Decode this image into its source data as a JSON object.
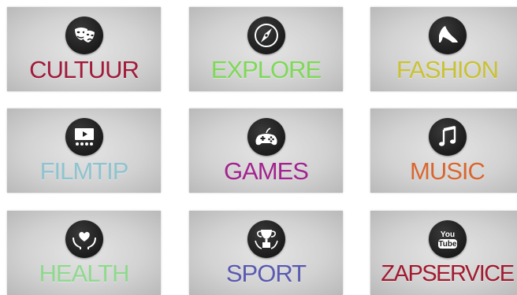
{
  "tiles": [
    {
      "label": "CULTUUR",
      "color": "#a11a3a",
      "icon": "theater-masks-icon"
    },
    {
      "label": "EXPLORE",
      "color": "#7ed957",
      "icon": "compass-icon"
    },
    {
      "label": "FASHION",
      "color": "#c9c236",
      "icon": "high-heel-icon"
    },
    {
      "label": "FILMTIP",
      "color": "#8fc3cf",
      "icon": "cinema-screen-icon"
    },
    {
      "label": "GAMES",
      "color": "#a2238e",
      "icon": "gamepad-icon"
    },
    {
      "label": "MUSIC",
      "color": "#d8662f",
      "icon": "music-note-icon"
    },
    {
      "label": "HEALTH",
      "color": "#8fd98f",
      "icon": "heart-hands-icon"
    },
    {
      "label": "SPORT",
      "color": "#5a5ab0",
      "icon": "trophy-icon"
    },
    {
      "label": "ZAPSERVICE",
      "color": "#a11a2e",
      "icon": "youtube-icon",
      "icon_text": {
        "top": "You",
        "bottom": "Tube"
      }
    }
  ]
}
